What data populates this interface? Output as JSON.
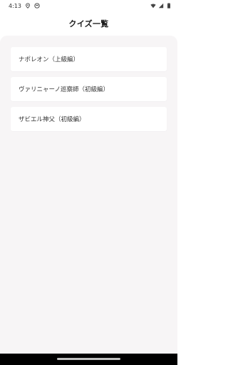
{
  "status_bar": {
    "time": "4:13",
    "icons": [
      "location-icon",
      "face-icon",
      "wifi-icon",
      "signal-icon",
      "battery-icon"
    ]
  },
  "header": {
    "title": "クイズ一覧"
  },
  "quiz_list": {
    "items": [
      {
        "label": "ナポレオン（上級編）"
      },
      {
        "label": "ヴァリニャーノ巡察師（初級編）"
      },
      {
        "label": "ザビエル神父（初級編）"
      }
    ]
  },
  "colors": {
    "background": "#ffffff",
    "content_background": "#f7f5f6",
    "card_background": "#ffffff",
    "nav_bar": "#000000"
  }
}
